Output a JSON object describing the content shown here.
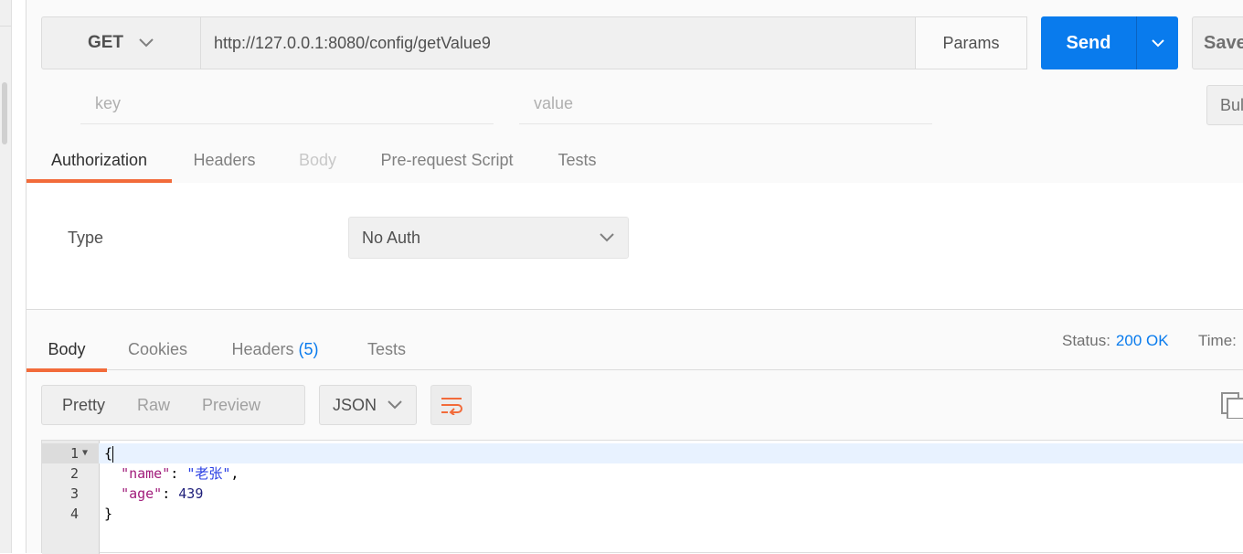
{
  "request": {
    "method": "GET",
    "url": "http://127.0.0.1:8080/config/getValue9",
    "params_label": "Params",
    "send_label": "Send",
    "save_label": "Save"
  },
  "params": {
    "key_placeholder": "key",
    "value_placeholder": "value",
    "bulk_label": "Bul"
  },
  "request_tabs": [
    {
      "label": "Authorization",
      "active": true
    },
    {
      "label": "Headers"
    },
    {
      "label": "Body",
      "disabled": true
    },
    {
      "label": "Pre-request Script"
    },
    {
      "label": "Tests"
    }
  ],
  "auth": {
    "type_label": "Type",
    "type_value": "No Auth"
  },
  "response_tabs": [
    {
      "label": "Body",
      "active": true
    },
    {
      "label": "Cookies"
    },
    {
      "label": "Headers",
      "count": "(5)"
    },
    {
      "label": "Tests"
    }
  ],
  "response": {
    "status_label": "Status:",
    "status_value": "200 OK",
    "time_label": "Time:",
    "format_tabs": [
      "Pretty",
      "Raw",
      "Preview"
    ],
    "language": "JSON",
    "code_lines": [
      "1",
      "2",
      "3",
      "4"
    ],
    "body": {
      "open": "{",
      "name_key": "\"name\"",
      "name_value": "\"老张\"",
      "age_key": "\"age\"",
      "age_value": "439",
      "close": "}"
    }
  },
  "colors": {
    "accent": "#f26b3a",
    "primary": "#097bed"
  }
}
